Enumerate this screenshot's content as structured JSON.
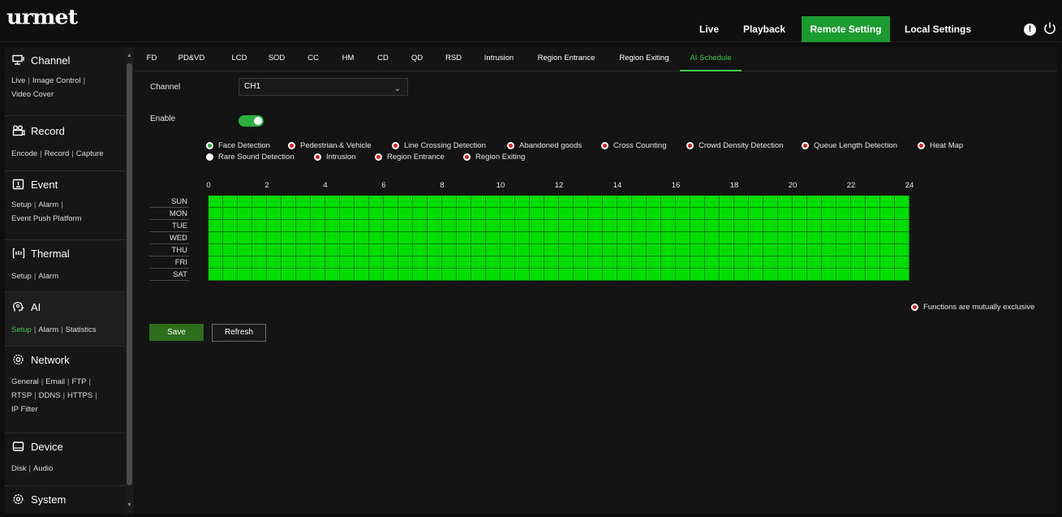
{
  "header": {
    "logo": "urmet",
    "nav": {
      "live": "Live",
      "playback": "Playback",
      "remote_setting": "Remote Setting",
      "local_settings": "Local Settings"
    },
    "alert_symbol": "!",
    "icons": [
      "alert-icon",
      "power-icon"
    ],
    "active_color": "#1c9b30"
  },
  "sidebar": {
    "sections": [
      {
        "title": "Channel",
        "icon": "monitor-icon",
        "links": [
          "Live",
          "Image Control",
          "Video Cover"
        ]
      },
      {
        "title": "Record",
        "icon": "record-icon",
        "links": [
          "Encode",
          "Record",
          "Capture"
        ]
      },
      {
        "title": "Event",
        "icon": "event-icon",
        "links": [
          "Setup",
          "Alarm",
          "Event Push Platform"
        ]
      },
      {
        "title": "Thermal",
        "icon": "thermal-icon",
        "links": [
          "Setup",
          "Alarm"
        ]
      },
      {
        "title": "AI",
        "icon": "ai-icon",
        "links": [
          "Setup",
          "Alarm",
          "Statistics"
        ],
        "selected_link": "Setup"
      },
      {
        "title": "Network",
        "icon": "network-icon",
        "links": [
          "General",
          "Email",
          "FTP",
          "RTSP",
          "DDNS",
          "HTTPS",
          "IP Filter"
        ]
      },
      {
        "title": "Device",
        "icon": "device-icon",
        "links": [
          "Disk",
          "Audio"
        ]
      },
      {
        "title": "System",
        "icon": "system-icon",
        "links": []
      }
    ]
  },
  "tabs": [
    "FD",
    "PD&VD",
    "LCD",
    "SOD",
    "CC",
    "HM",
    "CD",
    "QD",
    "RSD",
    "Intrusion",
    "Region Entrance",
    "Region Exiting",
    "AI Schedule"
  ],
  "active_tab": "AI Schedule",
  "form": {
    "channel_label": "Channel",
    "channel_value": "CH1",
    "enable_label": "Enable",
    "enable_on": true
  },
  "functions": {
    "row1": [
      {
        "label": "Face Detection",
        "state": "green"
      },
      {
        "label": "Pedestrian & Vehicle",
        "state": "red"
      },
      {
        "label": "Line Crossing Detection",
        "state": "red"
      },
      {
        "label": "Abandoned goods",
        "state": "red"
      },
      {
        "label": "Cross Counting",
        "state": "red"
      },
      {
        "label": "Crowd Density Detection",
        "state": "red"
      },
      {
        "label": "Queue Length Detection",
        "state": "red"
      },
      {
        "label": "Heat Map",
        "state": "red"
      }
    ],
    "row2": [
      {
        "label": "Rare Sound Detection",
        "state": "white"
      },
      {
        "label": "Intrusion",
        "state": "red"
      },
      {
        "label": "Region Entrance",
        "state": "red"
      },
      {
        "label": "Region Exiting",
        "state": "red"
      }
    ]
  },
  "schedule": {
    "hours": [
      "0",
      "2",
      "4",
      "6",
      "8",
      "10",
      "12",
      "14",
      "16",
      "18",
      "20",
      "22",
      "24"
    ],
    "days": [
      "SUN",
      "MON",
      "TUE",
      "WED",
      "THU",
      "FRI",
      "SAT"
    ],
    "slots_per_day": 48,
    "all_enabled": true,
    "fill_color": "#00dd00"
  },
  "legend": {
    "mutual": "Functions are mutually exclusive"
  },
  "buttons": {
    "save": "Save",
    "refresh": "Refresh"
  }
}
